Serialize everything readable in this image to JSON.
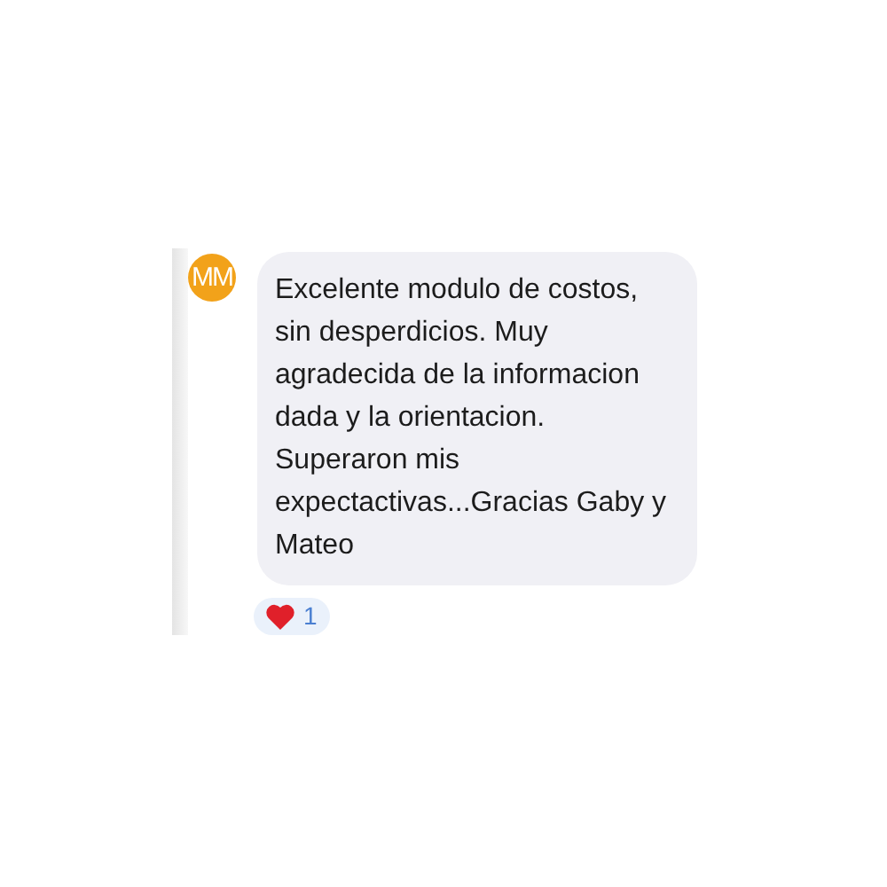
{
  "comment": {
    "avatar_initials": "MM",
    "text": "Excelente modulo de costos, sin desperdicios. Muy agradecida de la informacion dada y la orientacion. Superaron mis expectactivas...Gracias Gaby y Mateo",
    "reaction_count": "1"
  }
}
